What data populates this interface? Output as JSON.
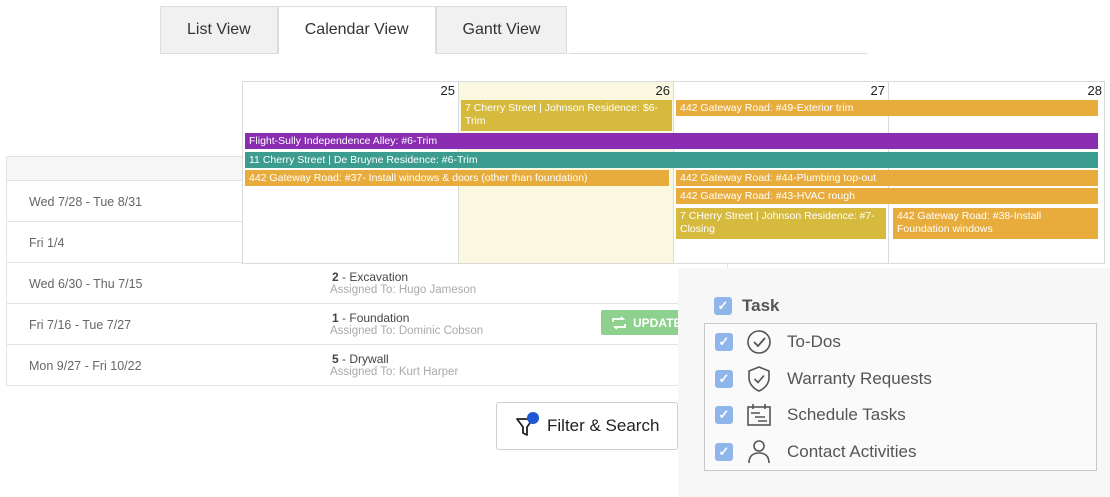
{
  "tabs": [
    "List View",
    "Calendar View",
    "Gantt View"
  ],
  "list": {
    "rows": [
      {
        "date": "Wed 7/28 - Tue 8/31",
        "num": "",
        "title": "",
        "assigned": ""
      },
      {
        "date": "Fri 1/4",
        "num": "",
        "title": "",
        "assigned": ""
      },
      {
        "date": "Wed 6/30 - Thu 7/15",
        "num": "2",
        "title": "Excavation",
        "assigned": "Assigned To: Hugo Jameson"
      },
      {
        "date": "Fri 7/16 - Tue 7/27",
        "num": "1",
        "title": "Foundation",
        "assigned": "Assigned To: Dominic Cobson"
      },
      {
        "date": "Mon 9/27 - Fri 10/22",
        "num": "5",
        "title": "Drywall",
        "assigned": "Assigned To: Kurt Harper"
      }
    ],
    "update_label": "UPDATE"
  },
  "filter": {
    "label": "Filter & Search",
    "icon": "filter-icon"
  },
  "calendar": {
    "days": [
      "25",
      "26",
      "27",
      "28"
    ],
    "events": [
      {
        "text": "7 Cherry Street | Johnson Residence: $6- Trim",
        "color": "olive"
      },
      {
        "text": "442 Gateway Road: #49-Exterior trim",
        "color": "orange"
      },
      {
        "text": "Flight-Sully Independence Alley: #6-Trim",
        "color": "purple"
      },
      {
        "text": "11 Cherry Street | De Bruyne Residence: #6-Trim",
        "color": "teal"
      },
      {
        "text": "442 Gateway Road: #37- Install windows & doors (other than foundation)",
        "color": "orange"
      },
      {
        "text": "442 Gateway Road: #44-Plumbing top-out",
        "color": "orange"
      },
      {
        "text": "442 Gateway Road: #43-HVAC rough",
        "color": "orange"
      },
      {
        "text": "7 CHerry Street | Johnson Residence: #7-Closing",
        "color": "olive"
      },
      {
        "text": "442 Gateway Road: #38-Install Foundation windows",
        "color": "orange"
      }
    ]
  },
  "legend": {
    "header": "Task",
    "items": [
      {
        "label": "To-Dos",
        "icon": "check-circle-icon"
      },
      {
        "label": "Warranty Requests",
        "icon": "shield-check-icon"
      },
      {
        "label": "Schedule Tasks",
        "icon": "calendar-list-icon"
      },
      {
        "label": "Contact Activities",
        "icon": "person-icon"
      }
    ]
  }
}
